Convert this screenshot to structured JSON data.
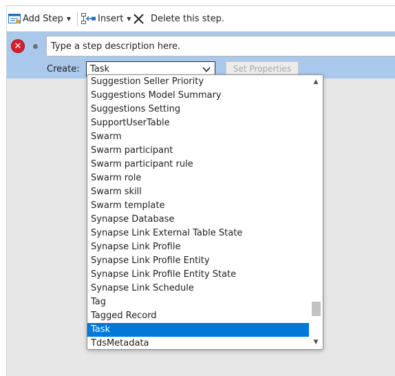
{
  "toolbar": {
    "add_step_label": "Add Step",
    "insert_label": "Insert",
    "delete_label": "Delete this step.",
    "icons": {
      "add_step": "add-step-icon",
      "insert": "insert-icon",
      "delete": "close-x-icon",
      "dropdown": "caret-down-icon"
    }
  },
  "step": {
    "error_icon": "error-icon",
    "description_placeholder": "Type a step description here."
  },
  "create": {
    "label": "Create:",
    "selected_value": "Task",
    "set_properties_label": "Set Properties"
  },
  "dropdown": {
    "options": [
      "Suggestion Seller Priority",
      "Suggestions Model Summary",
      "Suggestions Setting",
      "SupportUserTable",
      "Swarm",
      "Swarm participant",
      "Swarm participant rule",
      "Swarm role",
      "Swarm skill",
      "Swarm template",
      "Synapse Database",
      "Synapse Link External Table State",
      "Synapse Link Profile",
      "Synapse Link Profile Entity",
      "Synapse Link Profile Entity State",
      "Synapse Link Schedule",
      "Tag",
      "Tagged Record",
      "Task",
      "TdsMetadata"
    ],
    "selected_option": "Task"
  },
  "colors": {
    "step_band": "#a9c8ea",
    "selection": "#0078d7",
    "error": "#d3202a"
  }
}
